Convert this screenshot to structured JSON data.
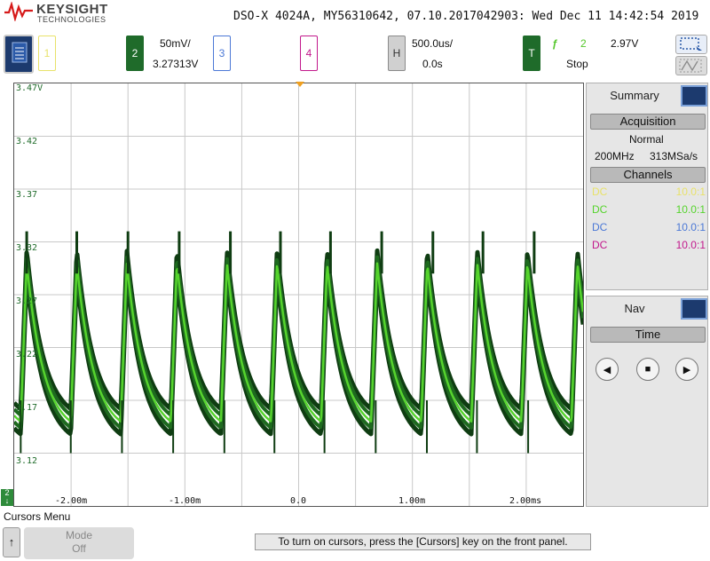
{
  "brand": {
    "name": "KEYSIGHT",
    "sub": "TECHNOLOGIES"
  },
  "header": {
    "info": "DSO-X 4024A, MY56310642, 07.10.2017042903: Wed Dec 11 14:42:54 2019"
  },
  "channels": {
    "ch1": {
      "label": "1"
    },
    "ch2": {
      "label": "2",
      "scale": "50mV/",
      "offset": "3.27313V"
    },
    "ch3": {
      "label": "3"
    },
    "ch4": {
      "label": "4"
    }
  },
  "horizontal": {
    "label": "H",
    "scale": "500.0us/",
    "delay": "0.0s"
  },
  "trigger": {
    "label": "T",
    "edge_symbol": "ƒ",
    "source": "2",
    "level": "2.97V",
    "run_state": "Stop"
  },
  "colors": {
    "ch1": "#e8e26a",
    "ch2": "#1f6b2a",
    "ch2_trace": "#56d42d",
    "ch3": "#4b78d6",
    "ch4": "#c2188c"
  },
  "grid": {
    "y_labels": [
      "3.47V",
      "3.42",
      "3.37",
      "3.32",
      "3.27",
      "3.22",
      "3.17",
      "3.12"
    ],
    "x_labels": [
      "-2.00m",
      "-1.00m",
      "0.0",
      "1.00m",
      "2.00ms"
    ],
    "ground_marker": "2"
  },
  "summary_panel": {
    "tab": "Summary",
    "acquisition_title": "Acquisition",
    "acq_mode": "Normal",
    "bandwidth": "200MHz",
    "sample_rate": "313MSa/s",
    "channels_title": "Channels",
    "channel_rows": [
      {
        "coupling": "DC",
        "probe": "10.0:1"
      },
      {
        "coupling": "DC",
        "probe": "10.0:1"
      },
      {
        "coupling": "DC",
        "probe": "10.0:1"
      },
      {
        "coupling": "DC",
        "probe": "10.0:1"
      }
    ]
  },
  "nav_panel": {
    "tab": "Nav",
    "mode": "Time"
  },
  "cursors_menu": {
    "title": "Cursors Menu",
    "up_arrow": "↑",
    "mode_label": "Mode",
    "mode_value": "Off"
  },
  "status_message": "To turn on cursors, press the [Cursors] key on the front panel.",
  "chart_data": {
    "type": "line",
    "series": [
      {
        "name": "2"
      }
    ],
    "x_unit": "s",
    "y_unit": "V",
    "xlim": [
      -0.0025,
      0.0025
    ],
    "ylim": [
      3.1,
      3.5
    ],
    "grid": true,
    "waveform": "sawtooth-like ripple, ~11 cycles across screen, peaks ~3.33V, troughs ~3.18V",
    "peaks_x": [
      -0.00239,
      -0.00195,
      -0.0015,
      -0.00105,
      -0.0006,
      -0.00016,
      0.00028,
      0.00073,
      0.00118,
      0.00162,
      0.00207
    ],
    "peak_y": 3.33,
    "trough_y": 3.18,
    "mid_y": 3.26
  }
}
